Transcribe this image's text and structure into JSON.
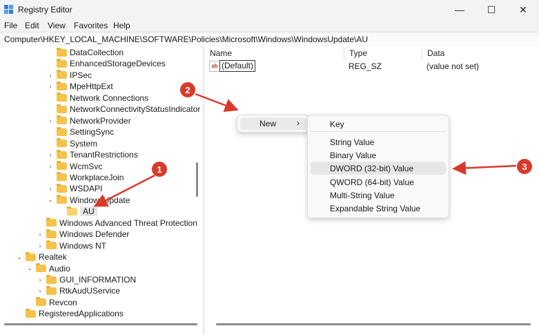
{
  "window": {
    "title": "Registry Editor",
    "controls": {
      "minimize": "—",
      "maximize": "☐",
      "close": "✕"
    }
  },
  "menu": [
    "File",
    "Edit",
    "View",
    "Favorites",
    "Help"
  ],
  "address": "Computer\\HKEY_LOCAL_MACHINE\\SOFTWARE\\Policies\\Microsoft\\Windows\\WindowsUpdate\\AU",
  "tree": [
    {
      "label": "DataCollection",
      "level": 3,
      "expander": "none"
    },
    {
      "label": "EnhancedStorageDevices",
      "level": 3,
      "expander": "none"
    },
    {
      "label": "IPSec",
      "level": 3,
      "expander": "collapsed"
    },
    {
      "label": "MpeHttpExt",
      "level": 3,
      "expander": "collapsed"
    },
    {
      "label": "Network Connections",
      "level": 3,
      "expander": "none"
    },
    {
      "label": "NetworkConnectivityStatusIndicator",
      "level": 3,
      "expander": "none"
    },
    {
      "label": "NetworkProvider",
      "level": 3,
      "expander": "collapsed"
    },
    {
      "label": "SettingSync",
      "level": 3,
      "expander": "none"
    },
    {
      "label": "System",
      "level": 3,
      "expander": "none"
    },
    {
      "label": "TenantRestrictions",
      "level": 3,
      "expander": "collapsed"
    },
    {
      "label": "WcmSvc",
      "level": 3,
      "expander": "collapsed"
    },
    {
      "label": "WorkplaceJoin",
      "level": 3,
      "expander": "none"
    },
    {
      "label": "WSDAPI",
      "level": 3,
      "expander": "collapsed"
    },
    {
      "label": "WindowsUpdate",
      "level": 3,
      "expander": "expanded"
    },
    {
      "label": "AU",
      "level": 4,
      "expander": "none",
      "selected": true
    },
    {
      "label": "Windows Advanced Threat Protection",
      "level": 2,
      "expander": "none"
    },
    {
      "label": "Windows Defender",
      "level": 2,
      "expander": "collapsed"
    },
    {
      "label": "Windows NT",
      "level": 2,
      "expander": "collapsed"
    },
    {
      "label": "Realtek",
      "level": 0,
      "expander": "expanded"
    },
    {
      "label": "Audio",
      "level": 1,
      "expander": "expanded"
    },
    {
      "label": "GUI_INFORMATION",
      "level": 2,
      "expander": "collapsed"
    },
    {
      "label": "RtkAudUService",
      "level": 2,
      "expander": "collapsed"
    },
    {
      "label": "Revcon",
      "level": 1,
      "expander": "none"
    },
    {
      "label": "RegisteredApplications",
      "level": 0,
      "expander": "none"
    }
  ],
  "columns": {
    "name": "Name",
    "type": "Type",
    "data": "Data"
  },
  "values": [
    {
      "icon": "ab",
      "name": "(Default)",
      "type": "REG_SZ",
      "data": "(value not set)"
    }
  ],
  "context_menu": {
    "new_label": "New",
    "arrow": "›"
  },
  "submenu": {
    "items": [
      "Key",
      "String Value",
      "Binary Value",
      "DWORD (32-bit) Value",
      "QWORD (64-bit) Value",
      "Multi-String Value",
      "Expandable String Value"
    ],
    "highlighted": "DWORD (32-bit) Value"
  },
  "annotations": {
    "color": "#d93a2b",
    "badges": [
      "1",
      "2",
      "3"
    ]
  }
}
